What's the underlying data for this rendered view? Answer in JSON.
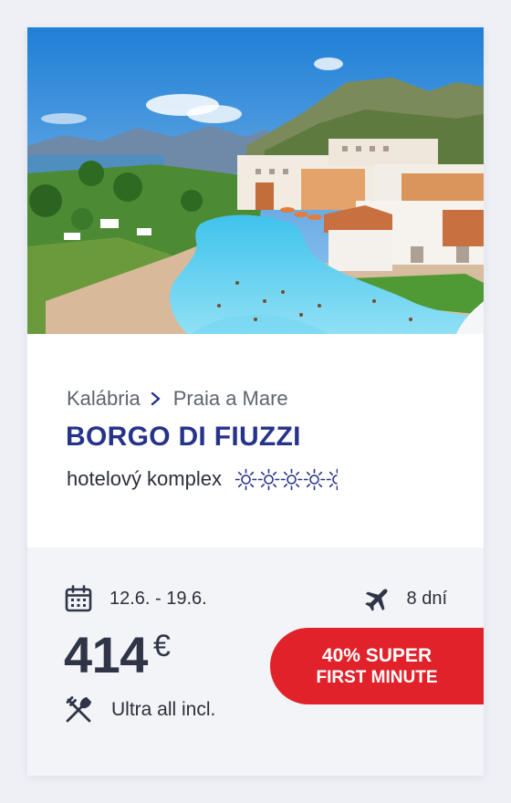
{
  "card": {
    "photo_alt": "",
    "location": {
      "region": "Kalábria",
      "city": "Praia a Mare"
    },
    "hotel_name": "BORGO DI FIUZZI",
    "category": "hotelový komplex",
    "rating": {
      "value": 4.5,
      "max": 5,
      "icon": "sun-icon"
    },
    "dates": "12.6. - 19.6.",
    "duration": "8 dní",
    "price": {
      "amount": "414",
      "currency": "€"
    },
    "board": "Ultra all incl.",
    "badge": {
      "line1": "40% SUPER",
      "line2": "FIRST MINUTE"
    },
    "colors": {
      "title": "#26338a",
      "badge": "#e2222a",
      "text": "#2b2f3a",
      "muted": "#5f6470"
    }
  }
}
